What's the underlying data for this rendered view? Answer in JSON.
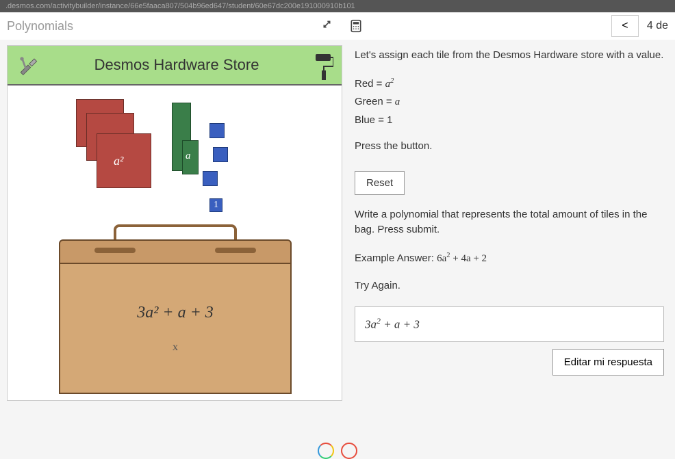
{
  "url": ".desmos.com/activitybuilder/instance/66e5faaca807/504b96ed647/student/60e67dc200e191000910b101",
  "breadcrumb": "Polynomials",
  "nav": {
    "back_symbol": "<",
    "right_text": "4 de"
  },
  "store": {
    "title": "Desmos Hardware Store",
    "red_label": "a²",
    "green_label": "a",
    "blue_label": "1",
    "bag_expression": "3a² + a + 3",
    "bag_x": "x"
  },
  "instructions": {
    "intro": "Let's assign each tile from the Desmos Hardware store with a value.",
    "red_prefix": "Red = ",
    "red_val_base": "a",
    "red_val_exp": "2",
    "green_prefix": "Green = ",
    "green_val": "a",
    "blue_prefix": "Blue = ",
    "blue_val": "1",
    "press": "Press the button.",
    "reset_label": "Reset",
    "write": "Write a polynomial that represents the total amount of tiles in the bag. Press submit.",
    "example_prefix": "Example Answer: ",
    "example_base1": "6a",
    "example_exp1": "2",
    "example_rest": " + 4a + 2",
    "try_again": "Try Again.",
    "answer_base1": "3a",
    "answer_exp1": "2",
    "answer_rest": " + a + 3",
    "edit_label": "Editar mi respuesta"
  }
}
